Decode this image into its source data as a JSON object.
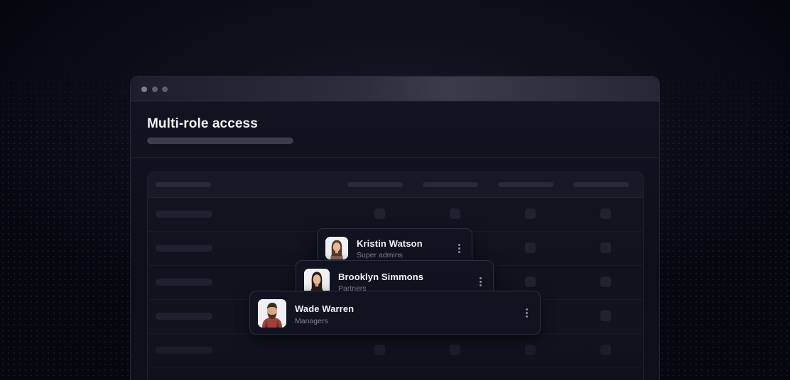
{
  "window": {
    "title": "Multi-role access"
  },
  "users": [
    {
      "name": "Kristin Watson",
      "role": "Super admins",
      "avatar_icon": "avatar-woman-icon"
    },
    {
      "name": "Brooklyn Simmons",
      "role": "Partners",
      "avatar_icon": "avatar-woman-icon"
    },
    {
      "name": "Wade Warren",
      "role": "Managers",
      "avatar_icon": "avatar-man-icon"
    }
  ],
  "colors": {
    "background": "#05070f",
    "window": "#0f121d",
    "card": "#111420",
    "text_primary": "#f3f4f8",
    "text_secondary": "#7e8293"
  }
}
